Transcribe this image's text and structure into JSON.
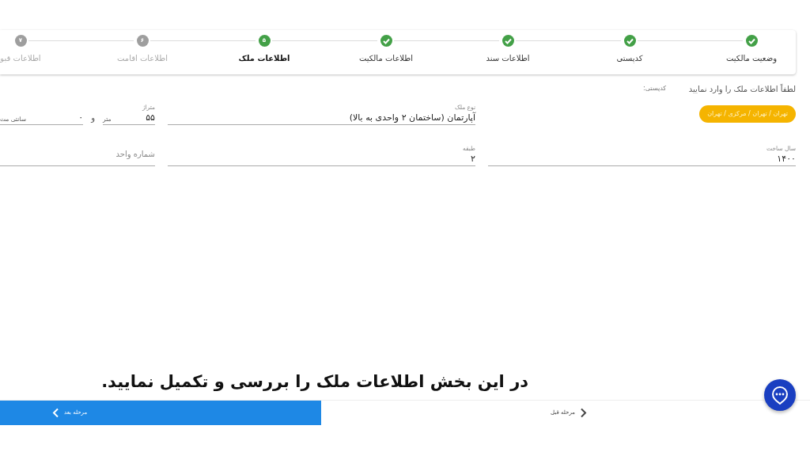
{
  "steps": [
    {
      "label": "وضعیت مالکیت",
      "completed": true,
      "selected": false
    },
    {
      "label": "کدپستی",
      "completed": true,
      "selected": false
    },
    {
      "label": "اطلاعات سند",
      "completed": true,
      "selected": false
    },
    {
      "label": "اطلاعات مالکیت",
      "completed": true,
      "selected": false
    },
    {
      "label": "اطلاعات ملک",
      "completed": false,
      "selected": true,
      "number": "۵"
    },
    {
      "label": "اطلاعات اقامت",
      "completed": false,
      "selected": false,
      "number": "۶"
    },
    {
      "label": "اطلاعات قبو",
      "completed": false,
      "selected": false,
      "number": "۷"
    }
  ],
  "form": {
    "instruction": "لطفاً اطلاعات ملک را وارد نمایید",
    "postal_code_label": "کدپستی:",
    "location": "تهران / تهران / مرکزی / تهران",
    "property_type": {
      "label": "نوع ملک",
      "value": "آپارتمان (ساختمان ۲ واحدی به بالا)"
    },
    "area": {
      "label": "متراژ",
      "value": "۵۵",
      "unit": "متر"
    },
    "and": "و",
    "area_cm": {
      "value": "۰",
      "unit": "سانتی مت"
    },
    "year_built": {
      "label": "سال ساخت",
      "value": "۱۴۰۰"
    },
    "floor": {
      "label": "طبقه",
      "value": "۲"
    },
    "unit_number": {
      "placeholder": "شماره واحد"
    }
  },
  "caption": "در این بخش اطلاعات ملک را بررسی و تکمیل نمایید.",
  "footer": {
    "previous": "مرحله قبل",
    "next": "مرحله بعد"
  }
}
